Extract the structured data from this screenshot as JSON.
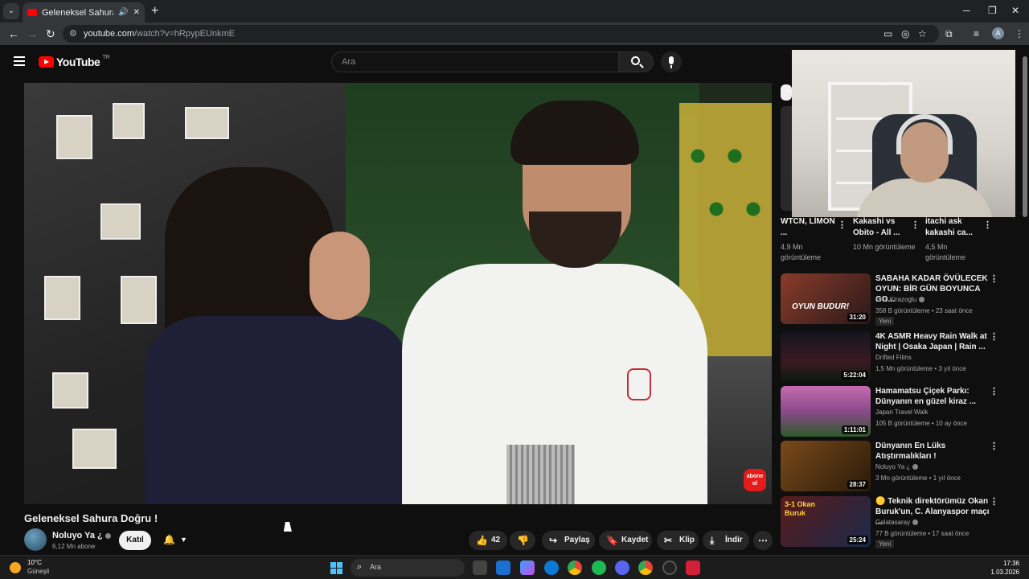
{
  "browser": {
    "tab_title": "Geleneksel Sahura Doğru !",
    "url_host": "youtube.com",
    "url_path": "/watch?v=hRpypEUnkmE",
    "new_tab_icon": "plus-icon",
    "profile_initial": "A"
  },
  "youtube": {
    "logo_text": "YouTube",
    "country_code": "TR",
    "search_placeholder": "Ara"
  },
  "video": {
    "title": "Geleneksel Sahura Doğru !",
    "channel_name": "Noluyo Ya ¿",
    "subscribers": "6,12 Mn abone",
    "join_label": "Katıl",
    "watermark": "abone ol",
    "actions": {
      "likes": "42 B",
      "share": "Paylaş",
      "save": "Kaydet",
      "clip": "Klip",
      "download": "İndir"
    }
  },
  "shorts": [
    {
      "title": "WTCN, LİMON ...",
      "views": "4,9 Mn görüntüleme"
    },
    {
      "title": "Kakashi vs Obito - All ...",
      "views": "10 Mn görüntüleme"
    },
    {
      "title": "itachi ask kakashi ca...",
      "views": "4,5 Mn görüntüleme"
    }
  ],
  "recommendations": [
    {
      "title": "SABAHA KADAR ÖVÜLECEK OYUN: BİR GÜN BOYUNCA GO...",
      "channel": "Enis Kirazoglu",
      "meta": "358 B görüntüleme • 23 saat önce",
      "badge": "Yeni",
      "duration": "31:20",
      "thumb_text": "OYUN BUDUR!",
      "color": "#6b2a2a"
    },
    {
      "title": "4K ASMR Heavy Rain Walk at Night | Osaka Japan | Rain ...",
      "channel": "Drifted Films",
      "meta": "1,5 Mn görüntüleme • 3 yıl önce",
      "badge": "",
      "duration": "5:22:04",
      "thumb_text": "",
      "color": "#1a1a22"
    },
    {
      "title": "Hamamatsu Çiçek Parkı: Dünyanın en güzel kiraz ...",
      "channel": "Japan Travel Walk",
      "meta": "105 B görüntüleme • 10 ay önce",
      "badge": "",
      "duration": "1:11:01",
      "thumb_text": "",
      "color": "#b7589a"
    },
    {
      "title": "Dünyanın En Lüks Atıştırmalıkları !",
      "channel": "Noluyo Ya ¿",
      "meta": "3 Mn görüntüleme • 1 yıl önce",
      "badge": "",
      "duration": "28:37",
      "thumb_text": "",
      "color": "#5a3a1a"
    },
    {
      "title": "🟡 Teknik direktörümüz Okan Buruk'un, C. Alanyaspor maçı ...",
      "channel": "Galatasaray",
      "meta": "77 B görüntüleme • 17 saat önce",
      "badge": "Yeni",
      "duration": "25:24",
      "thumb_text": "3-1 Okan Buruk",
      "color": "#3a1a1a"
    }
  ],
  "taskbar": {
    "temperature": "10°C",
    "weather": "Güneşli",
    "search_label": "Ara",
    "time": "17:36",
    "date": "1.03.2026"
  }
}
